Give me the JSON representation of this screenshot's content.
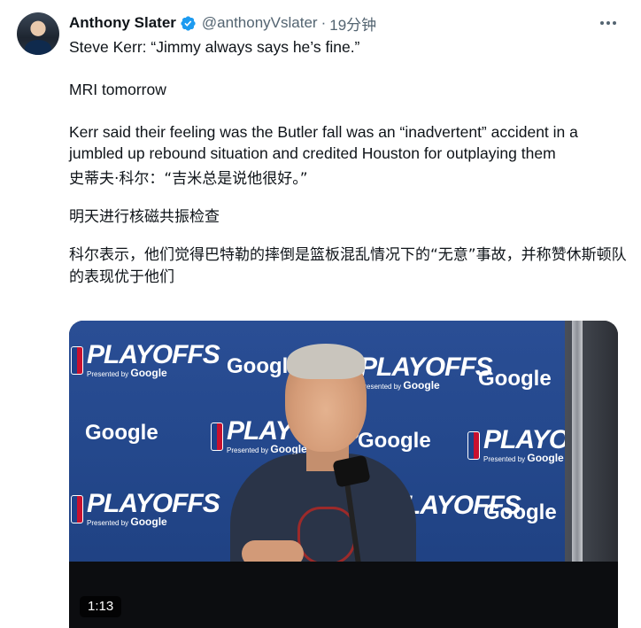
{
  "tweet": {
    "author_name": "Anthony Slater",
    "handle": "@anthonyVslater",
    "separator": "·",
    "time": "19分钟",
    "lines": [
      "Steve Kerr: “Jimmy always says he’s fine.”",
      "MRI tomorrow",
      "Kerr said their feeling was the Butler fall was an “inadvertent” accident in a jumbled up rebound situation and credited Houston for outplaying them",
      "史蒂夫·科尔：“吉米总是说他很好。”",
      "明天进行核磁共振检查",
      "科尔表示，他们觉得巴特勒的摔倒是篮板混乱情况下的“无意”事故，并称赞休斯顿队的表现优于他们"
    ]
  },
  "media": {
    "duration": "1:13",
    "backdrop_text": {
      "playoffs": "PLAYOFFS",
      "presented_by": "Presented by",
      "google": "Google"
    }
  },
  "icons": {
    "verified": "verified-badge-icon",
    "more": "more-options-icon"
  },
  "colors": {
    "verified": "#1d9bf0",
    "secondary_text": "#536471",
    "backdrop": "#24488c"
  }
}
